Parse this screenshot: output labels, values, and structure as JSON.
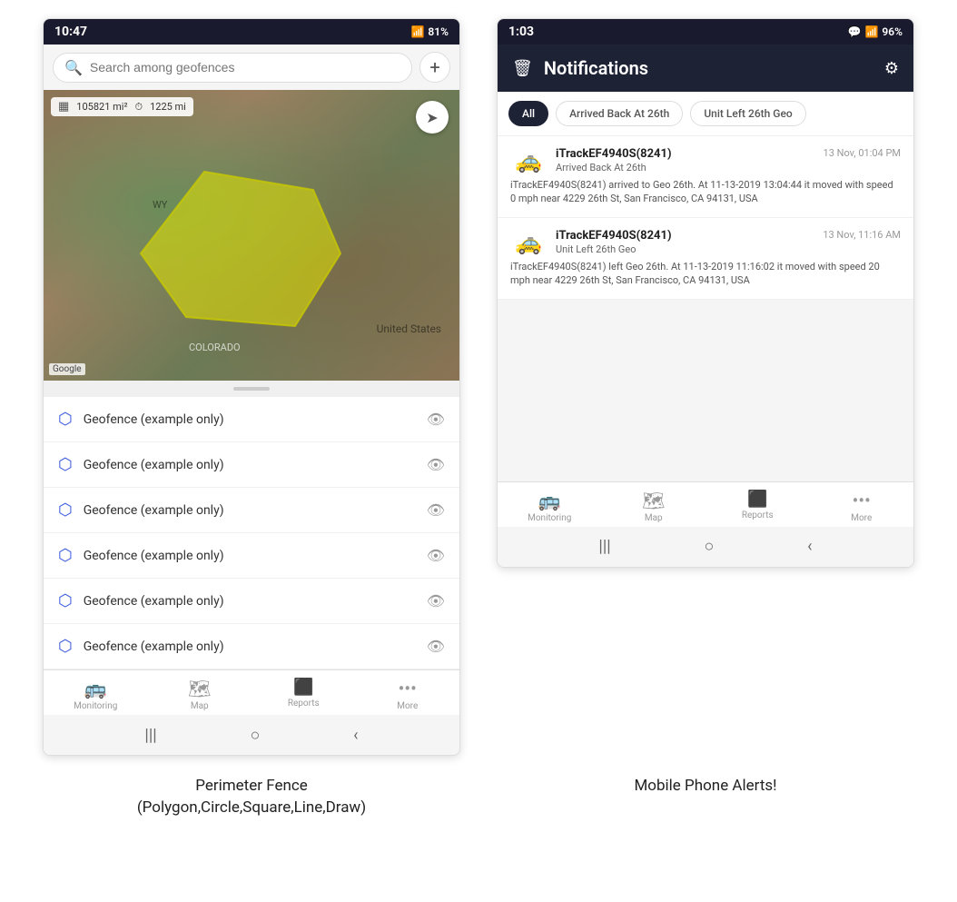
{
  "left_phone": {
    "status_bar": {
      "time": "10:47",
      "signal": "WiFi",
      "battery": "81%"
    },
    "search": {
      "placeholder": "Search among geofences"
    },
    "map": {
      "stats_area": "105821 mi²",
      "stats_dist": "1225 mi",
      "wy_label": "WY",
      "us_label": "United States",
      "co_label": "COLORADO",
      "attribution": "Google"
    },
    "geofences": [
      {
        "name": "Geofence (example only)"
      },
      {
        "name": "Geofence (example only)"
      },
      {
        "name": "Geofence (example only)"
      },
      {
        "name": "Geofence (example only)"
      },
      {
        "name": "Geofence (example only)"
      },
      {
        "name": "Geofence (example only)"
      }
    ],
    "nav": {
      "items": [
        {
          "label": "Monitoring",
          "icon": "🚌"
        },
        {
          "label": "Map",
          "icon": "🗺"
        },
        {
          "label": "Reports",
          "icon": "📊"
        },
        {
          "label": "More",
          "icon": "···"
        }
      ]
    }
  },
  "right_phone": {
    "status_bar": {
      "time": "1:03",
      "battery": "96%"
    },
    "header": {
      "title": "Notifications"
    },
    "filters": [
      {
        "label": "All",
        "active": true
      },
      {
        "label": "Arrived Back At 26th",
        "active": false
      },
      {
        "label": "Unit Left 26th Geo",
        "active": false
      }
    ],
    "notifications": [
      {
        "device": "iTrackEF4940S(8241)",
        "time": "13 Nov, 01:04 PM",
        "subtitle": "Arrived Back At 26th",
        "body": "iTrackEF4940S(8241) arrived to Geo 26th.   At 11-13-2019 13:04:44 it moved with speed 0 mph near 4229 26th St, San Francisco, CA 94131, USA"
      },
      {
        "device": "iTrackEF4940S(8241)",
        "time": "13 Nov, 11:16 AM",
        "subtitle": "Unit Left 26th Geo",
        "body": "iTrackEF4940S(8241) left Geo 26th.   At 11-13-2019 11:16:02 it moved with speed 20 mph near 4229 26th St, San Francisco, CA 94131, USA"
      }
    ],
    "nav": {
      "items": [
        {
          "label": "Monitoring",
          "icon": "🚌"
        },
        {
          "label": "Map",
          "icon": "🗺"
        },
        {
          "label": "Reports",
          "icon": "📊"
        },
        {
          "label": "More",
          "icon": "···"
        }
      ]
    }
  },
  "captions": {
    "left": "Perimeter Fence\n(Polygon,Circle,Square,Line,Draw)",
    "right": "Mobile Phone Alerts!"
  }
}
